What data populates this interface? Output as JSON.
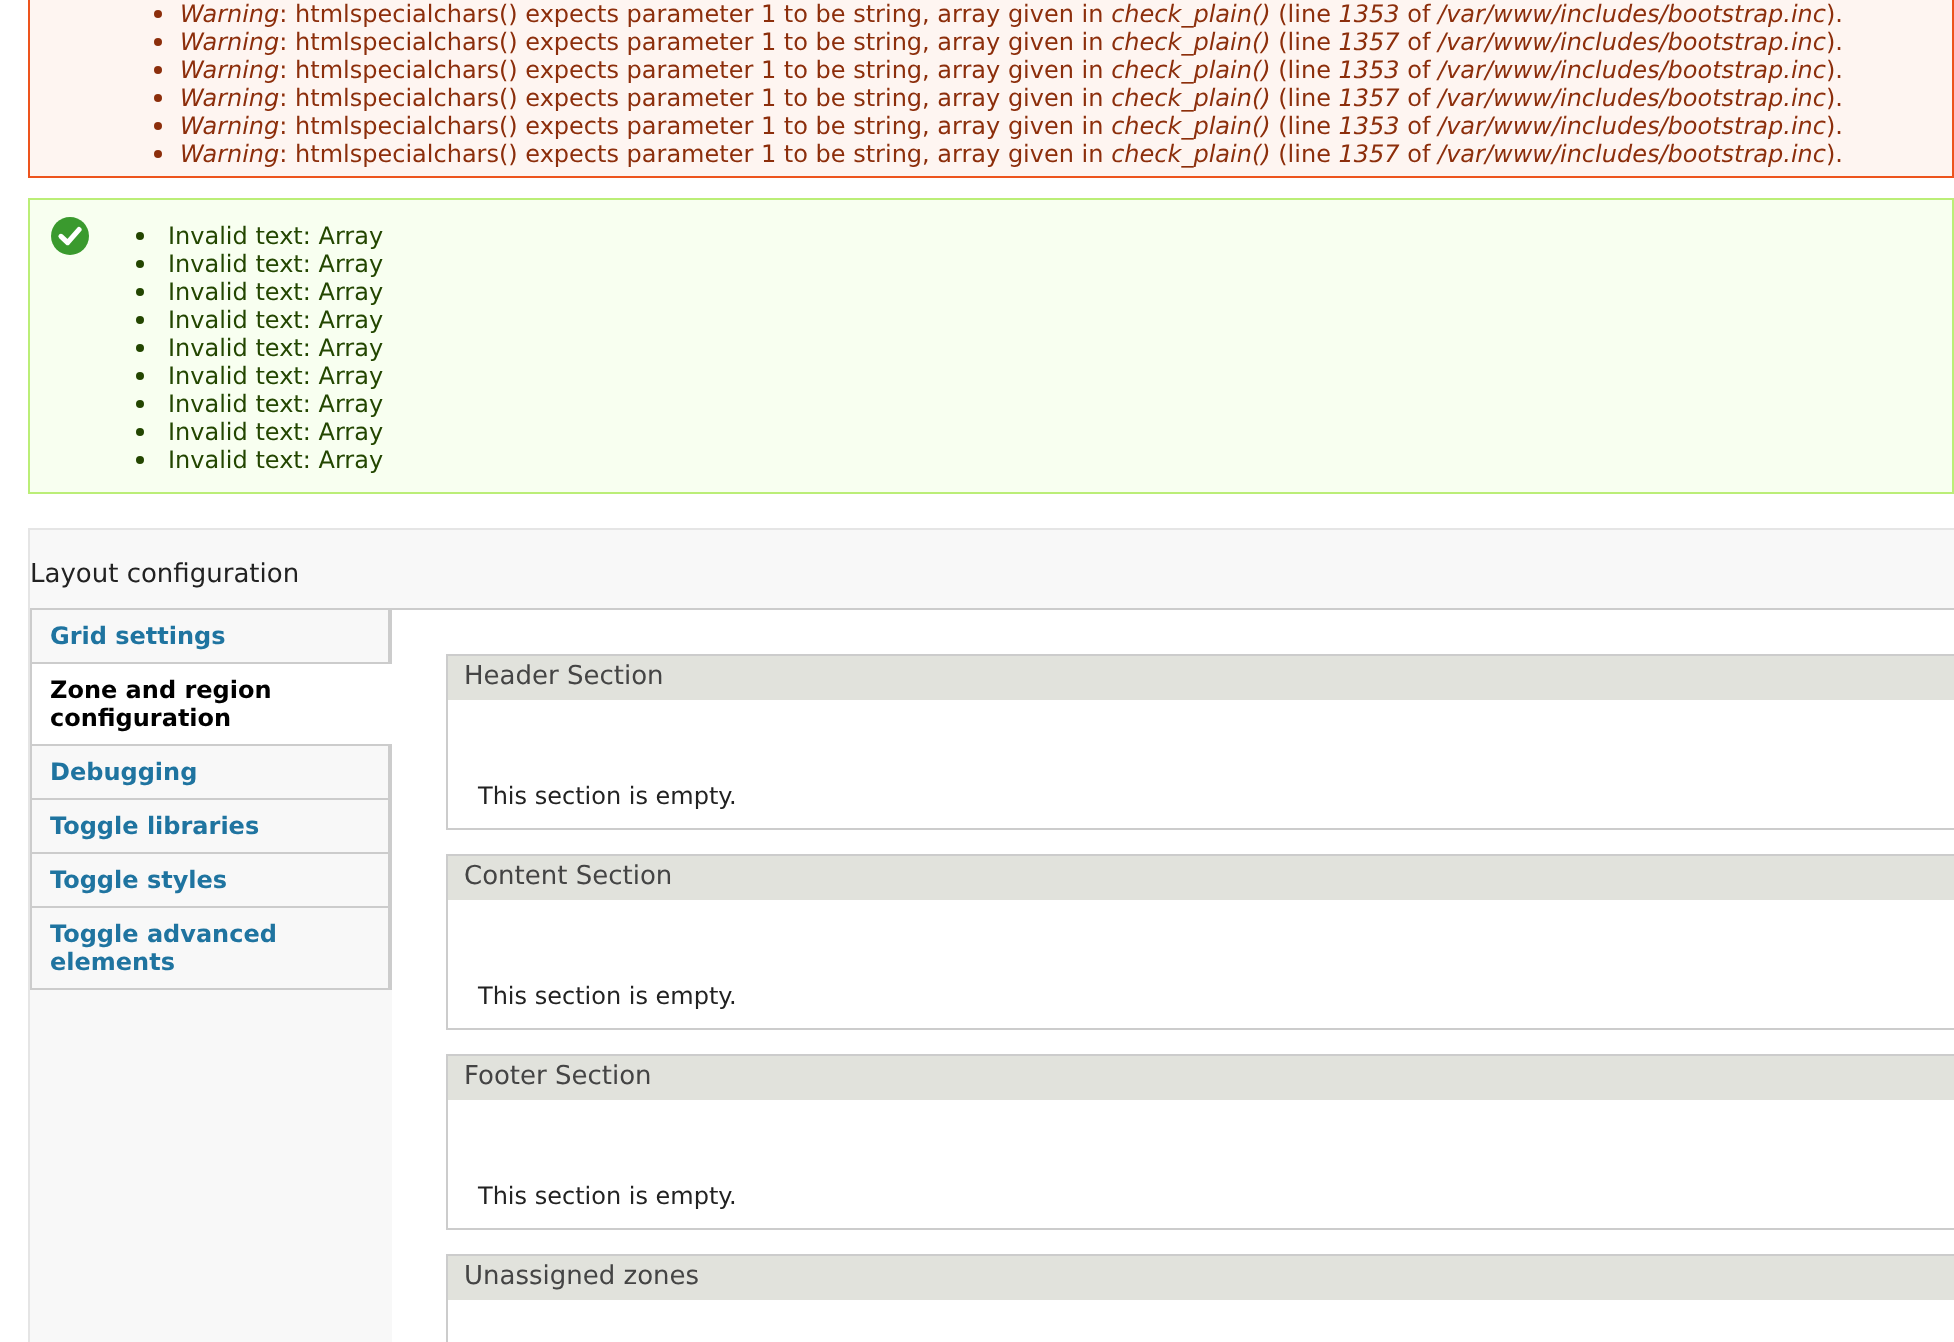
{
  "error_messages": [
    "*Warning*: htmlspecialchars() expects parameter 1 to be string, array given in *check_plain()* (line *1353* of */var/www/includes/bootstrap.inc*).",
    "*Warning*: htmlspecialchars() expects parameter 1 to be string, array given in *check_plain()* (line *1357* of */var/www/includes/bootstrap.inc*).",
    "*Warning*: htmlspecialchars() expects parameter 1 to be string, array given in *check_plain()* (line *1353* of */var/www/includes/bootstrap.inc*).",
    "*Warning*: htmlspecialchars() expects parameter 1 to be string, array given in *check_plain()* (line *1357* of */var/www/includes/bootstrap.inc*).",
    "*Warning*: htmlspecialchars() expects parameter 1 to be string, array given in *check_plain()* (line *1353* of */var/www/includes/bootstrap.inc*).",
    "*Warning*: htmlspecialchars() expects parameter 1 to be string, array given in *check_plain()* (line *1357* of */var/www/includes/bootstrap.inc*)."
  ],
  "status_messages": [
    "Invalid text: Array",
    "Invalid text: Array",
    "Invalid text: Array",
    "Invalid text: Array",
    "Invalid text: Array",
    "Invalid text: Array",
    "Invalid text: Array",
    "Invalid text: Array",
    "Invalid text: Array"
  ],
  "fieldset": {
    "legend": "Layout configuration",
    "tabs": [
      {
        "label": "Grid settings",
        "selected": false
      },
      {
        "label": "Zone and region configuration",
        "selected": true
      },
      {
        "label": "Debugging",
        "selected": false
      },
      {
        "label": "Toggle libraries",
        "selected": false
      },
      {
        "label": "Toggle styles",
        "selected": false
      },
      {
        "label": "Toggle advanced elements",
        "selected": false
      }
    ],
    "sections": [
      {
        "title": "Header Section",
        "body": "This section is empty."
      },
      {
        "title": "Content Section",
        "body": "This section is empty."
      },
      {
        "title": "Footer Section",
        "body": "This section is empty."
      },
      {
        "title": "Unassigned zones"
      }
    ]
  }
}
